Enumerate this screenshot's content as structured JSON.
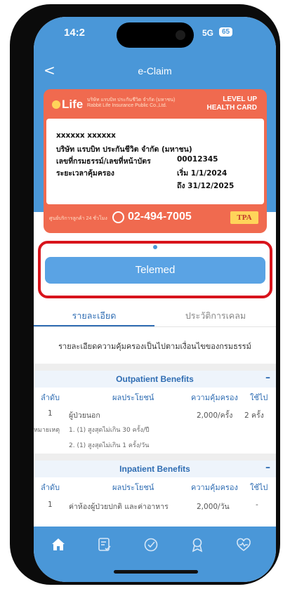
{
  "status_bar": {
    "time": "14:2",
    "network": "5G",
    "battery": "65"
  },
  "nav": {
    "back_glyph": "<",
    "title": "e-Claim"
  },
  "card": {
    "insurer_th": "บริษัท แรบบิท ประกันชีวิต จำกัด (มหาชน)",
    "insurer_en": "Rabbit Life Insurance Public Co.,Ltd.",
    "logo_text": "Life",
    "level_line1": "LEVEL UP",
    "level_line2": "HEALTH CARD",
    "holder_name": "xxxxxx  xxxxxx",
    "company": "บริษัท แรบบิท ประกันชีวิต จำกัด (มหาชน)",
    "policy_label": "เลขที่กรมธรรม์/เลขที่หน้าบัตร",
    "policy_number": "00012345",
    "period_label": "ระยะเวลาคุ้มครอง",
    "period_start": "เริ่ม 1/1/2024",
    "period_end": "ถึง 31/12/2025",
    "hotline_label": "ศูนย์บริการลูกค้า 24 ชั่วโมง",
    "hotline": "02-494-7005",
    "tpa": "TPA"
  },
  "telemed_button": "Telemed",
  "tabs": {
    "detail": "รายละเอียด",
    "history": "ประวัติการเคลม"
  },
  "description": "รายละเอียดความคุ้มครองเป็นไปตามเงื่อนไขของกรมธรรม์",
  "columns": {
    "no": "ลำดับ",
    "benefit": "ผลประโยชน์",
    "coverage": "ความคุ้มครอง",
    "used": "ใช้ไป"
  },
  "outpatient": {
    "title": "Outpatient Benefits",
    "collapse": "–",
    "rows": [
      {
        "no": "1",
        "benefit": "ผู้ป่วยนอก",
        "coverage": "2,000/ครั้ง",
        "used": "2 ครั้ง"
      }
    ],
    "note_label": "หมายเหตุ",
    "notes": [
      "1. (1) สูงสุดไม่เกิน 30 ครั้ง/ปี",
      "2. (1) สูงสุดไม่เกิน 1 ครั้ง/วัน"
    ]
  },
  "inpatient": {
    "title": "Inpatient Benefits",
    "collapse": "–",
    "rows": [
      {
        "no": "1",
        "benefit": "ค่าห้องผู้ป่วยปกติ และค่าอาหาร",
        "coverage": "2,000/วัน",
        "used": "-"
      }
    ]
  },
  "tabbar_icons": [
    "home-icon",
    "claim-list-icon",
    "check-circle-icon",
    "award-icon",
    "heart-pulse-icon"
  ]
}
